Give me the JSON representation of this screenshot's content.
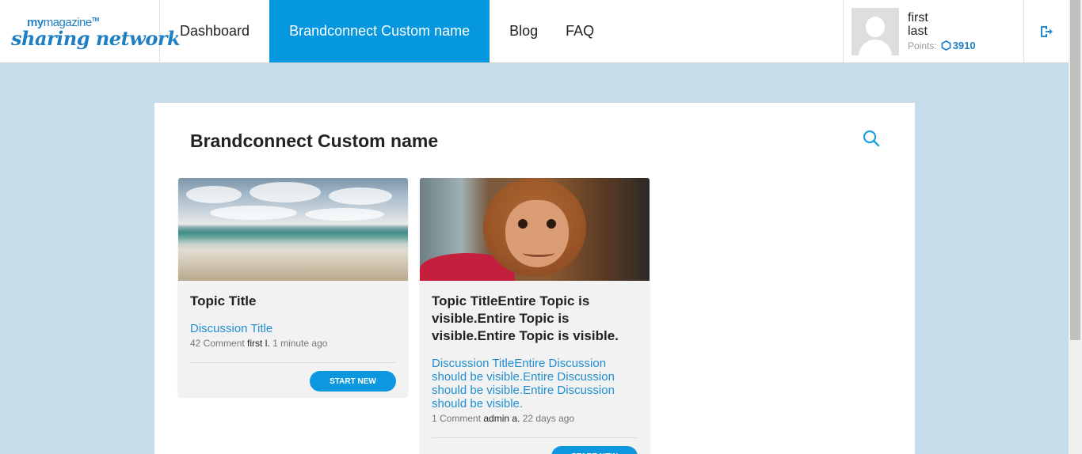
{
  "logo": {
    "top_my": "my",
    "top_magazine": "magazine",
    "tm": "TM",
    "bottom": "sharing network"
  },
  "nav": {
    "items": [
      {
        "label": "Dashboard"
      },
      {
        "label": "Brandconnect Custom name"
      },
      {
        "label": "Blog"
      },
      {
        "label": "FAQ"
      }
    ]
  },
  "profile": {
    "first": "first",
    "last": "last",
    "points_label": "Points:",
    "points_value": "3910"
  },
  "page": {
    "title": "Brandconnect Custom name"
  },
  "cards": [
    {
      "topic_title": "Topic Title",
      "discussion_title": "Discussion Title",
      "comments": "42 Comment",
      "author": "first l.",
      "time": "1 minute ago",
      "button": "START NEW"
    },
    {
      "topic_title": "Topic TitleEntire Topic is visible.Entire Topic is visible.Entire Topic is visible.",
      "discussion_title": "Discussion TitleEntire Discussion should be visible.Entire Discussion should be visible.Entire Discussion should be visible.",
      "comments": "1 Comment",
      "author": "admin a.",
      "time": "22 days ago",
      "button": "START NEW"
    }
  ],
  "colors": {
    "accent": "#0597e0",
    "link": "#1f8fd1",
    "background": "#c6dceb"
  }
}
